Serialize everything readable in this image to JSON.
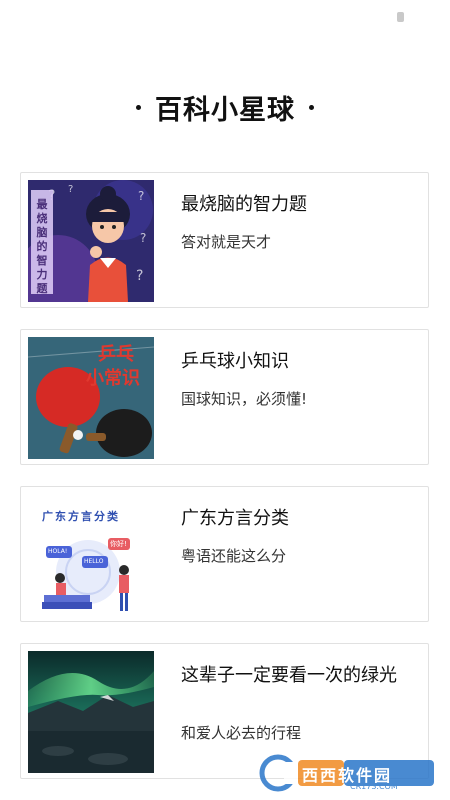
{
  "page_title": "百科小星球",
  "cards": [
    {
      "title": "最烧脑的智力题",
      "subtitle": "答对就是天才",
      "image_text": "最烧脑的智力题"
    },
    {
      "title": "乒乓球小知识",
      "subtitle": "国球知识，必须懂!",
      "image_text_1": "乒乓",
      "image_text_2": "小常识"
    },
    {
      "title": "广东方言分类",
      "subtitle": "粤语还能这么分",
      "image_text": "广东方言分类",
      "bubble_1": "HOLA!",
      "bubble_2": "HELLO",
      "bubble_3": "你好!"
    },
    {
      "title": "这辈子一定要看一次的绿光",
      "subtitle": "和爱人必去的行程"
    }
  ],
  "watermark": {
    "brand": "西西软件园",
    "url": "CR173.COM"
  },
  "colors": {
    "card_border": "#e1e1e1",
    "title": "#111111",
    "subtitle": "#333333"
  }
}
